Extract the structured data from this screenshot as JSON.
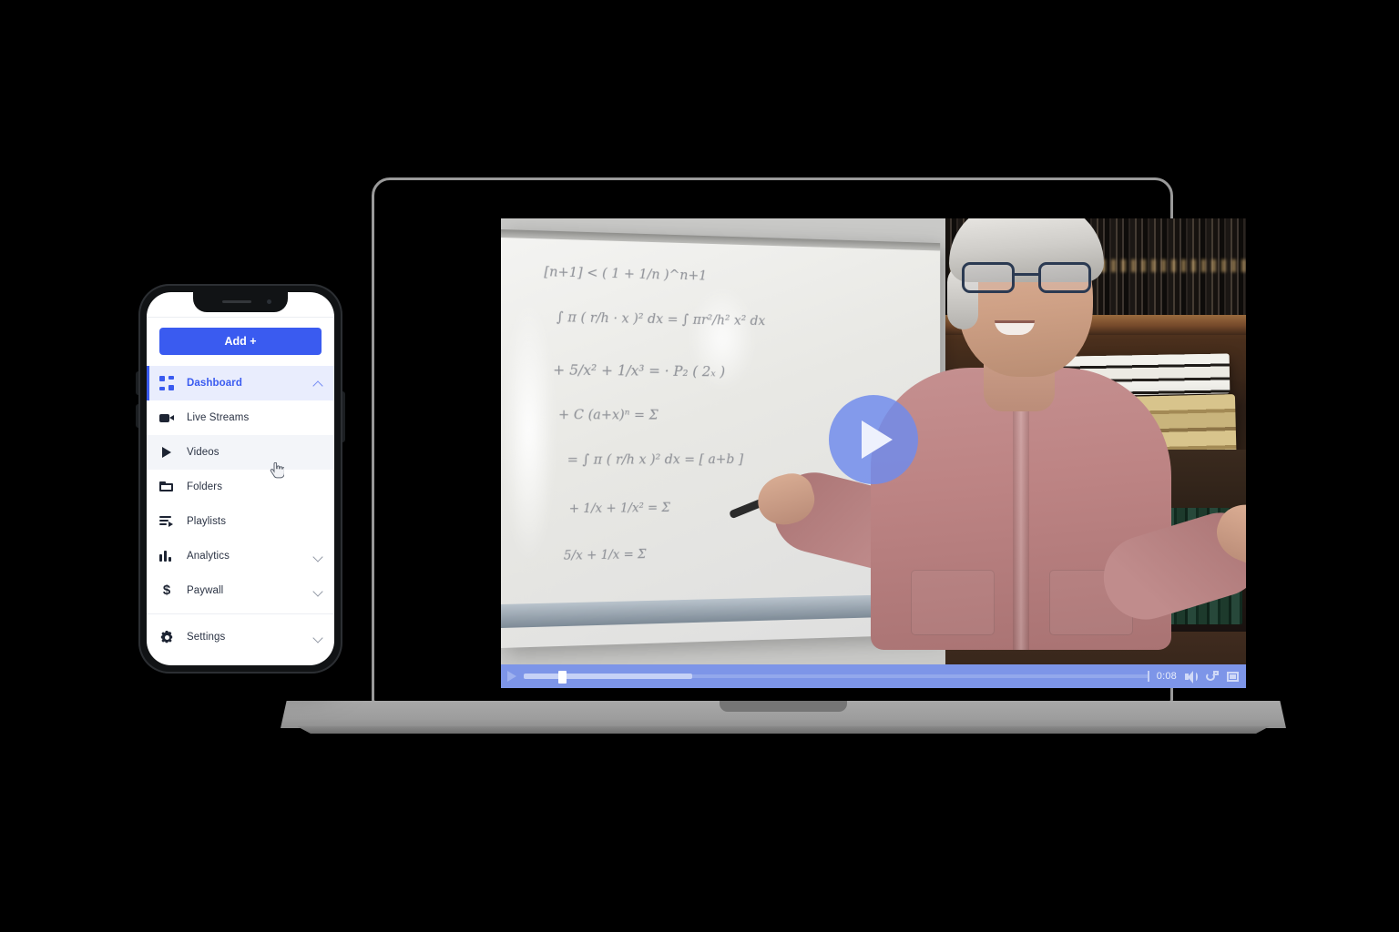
{
  "page": {
    "background_color": "#000000",
    "title": "Video platform device mockup"
  },
  "laptop": {
    "device": "laptop",
    "video_player": {
      "state": "paused",
      "overlay_play_icon": "play-icon",
      "scene_description": "Instructor at whiteboard with math equations in front of a bookshelf",
      "controls": {
        "play_label": "play-icon",
        "current_time": "0:08",
        "progress_percent": 5.6,
        "buffered_percent": 27,
        "volume_icon": "volume-icon",
        "loop_icon": "loop-icon",
        "fullscreen_icon": "fullscreen-icon",
        "bar_color": "#7d95e8"
      }
    },
    "whiteboard_equations": [
      "[n+1] < ( 1 + 1/n )^n+1",
      "∫ π ( r/h · x )² dx = ∫ πr²/h² x² dx",
      "+ 5/x² + 1/x³ = · P₂ ( 2ₓ )",
      "+ C (a+x)ⁿ = Σ",
      "= ∫ π ( r/h x )² dx = [ a+b ]",
      "+ 1/x + 1/x² = Σ",
      "5/x + 1/x = Σ"
    ]
  },
  "phone": {
    "device": "phone",
    "app": {
      "add_button_label": "Add +",
      "accent_color": "#3a5bf0",
      "active_item_background": "#e9edfd",
      "hover_item_background": "#f3f5f9",
      "nav_items": [
        {
          "label": "Dashboard",
          "icon": "dashboard-grid-icon",
          "state": "active",
          "chevron": "up"
        },
        {
          "label": "Live Streams",
          "icon": "video-camera-icon",
          "state": "default",
          "chevron": "none"
        },
        {
          "label": "Videos",
          "icon": "play-icon",
          "state": "hover",
          "chevron": "none"
        },
        {
          "label": "Folders",
          "icon": "folder-icon",
          "state": "default",
          "chevron": "none"
        },
        {
          "label": "Playlists",
          "icon": "playlist-icon",
          "state": "default",
          "chevron": "none"
        },
        {
          "label": "Analytics",
          "icon": "bar-chart-icon",
          "state": "default",
          "chevron": "down"
        },
        {
          "label": "Paywall",
          "icon": "dollar-sign-icon",
          "state": "default",
          "chevron": "down"
        }
      ],
      "footer_items": [
        {
          "label": "Settings",
          "icon": "gear-icon",
          "state": "default",
          "chevron": "down"
        }
      ]
    },
    "cursor": {
      "type": "pointer-hand-cursor",
      "over_item": "Videos"
    }
  }
}
